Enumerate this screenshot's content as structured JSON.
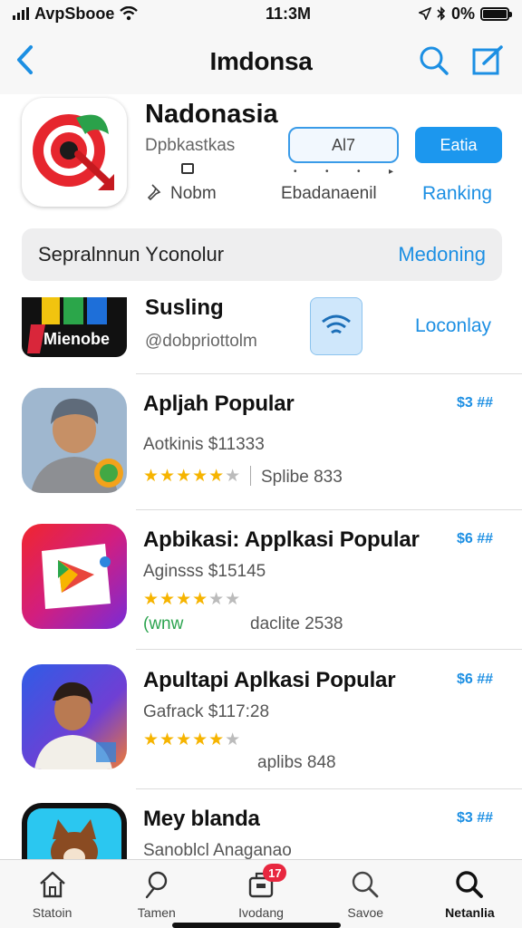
{
  "status_bar": {
    "carrier": "AvpSbooe",
    "time": "11:3M",
    "battery": "0%"
  },
  "nav": {
    "title": "Imdonsa"
  },
  "featured": {
    "title": "Nadonasia",
    "subtitle": "Dpbkastkas",
    "meta_left": "Nobm",
    "ghost_button": "Al7",
    "meta_center": "Ebadanaenil",
    "primary_button": "Eatia",
    "ranking_link": "Ranking"
  },
  "promo": {
    "text": "Sepralnnun Yconolur",
    "link": "Medoning"
  },
  "sponsored": {
    "icon_text": "Mienobe",
    "title": "Susling",
    "subtitle": "@dobpriottolm",
    "link": "Loconlay"
  },
  "apps": [
    {
      "title": "Apljah Popular",
      "price": "$3 ##",
      "subtitle": "Aotkinis $11333",
      "rating": 4.5,
      "extra": "Splibe 833",
      "tag": ""
    },
    {
      "title": "Apbikasi: Applkasi Popular",
      "price": "$6 ##",
      "subtitle": "Aginsss $15145",
      "rating": 4,
      "extra": "daclite 2538",
      "tag": "(wnw"
    },
    {
      "title": "Apultapi Aplkasi Popular",
      "price": "$6 ##",
      "subtitle": "Gafrack $117:28",
      "rating": 4,
      "extra": "aplibs 848",
      "tag": ""
    },
    {
      "title": "Mey blanda",
      "price": "$3 ##",
      "subtitle": "Sanoblcl Anaganao",
      "rating": 0,
      "extra": "",
      "tag": ""
    }
  ],
  "tabs": [
    {
      "label": "Statoin",
      "icon": "home-icon",
      "badge": ""
    },
    {
      "label": "Tamen",
      "icon": "pin-icon",
      "badge": ""
    },
    {
      "label": "Ivodang",
      "icon": "briefcase-icon",
      "badge": "17"
    },
    {
      "label": "Savoe",
      "icon": "search-icon",
      "badge": ""
    },
    {
      "label": "Netanlia",
      "icon": "search-icon",
      "badge": ""
    }
  ],
  "colors": {
    "accent": "#1c97ee",
    "star": "#f6b400",
    "badge": "#e8273f"
  }
}
